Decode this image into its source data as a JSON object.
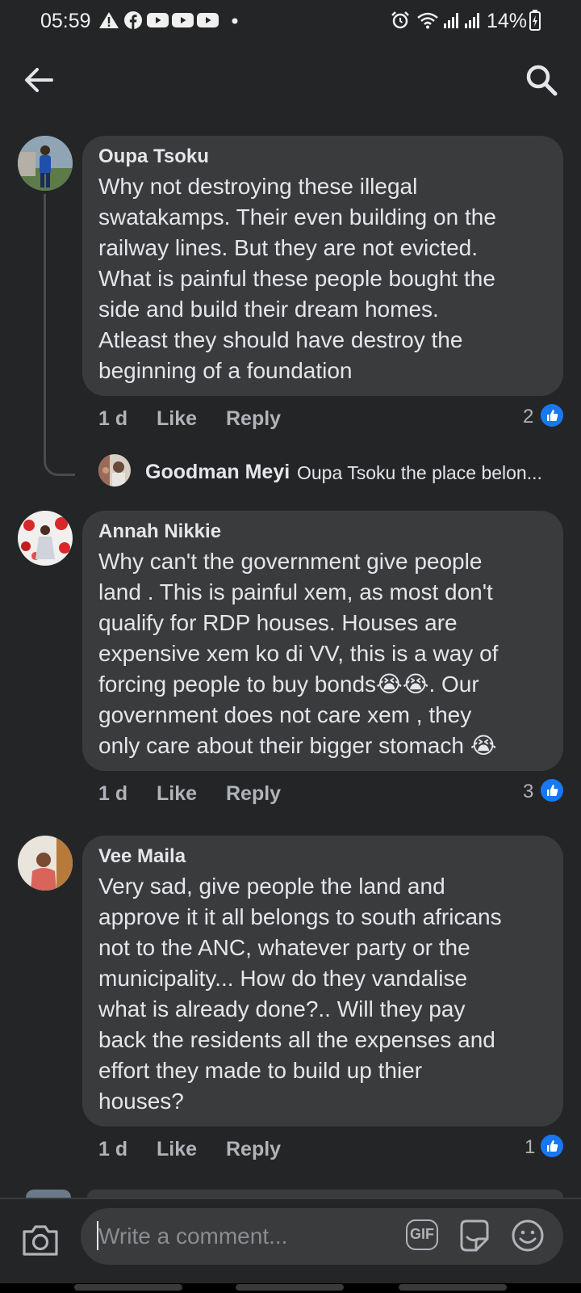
{
  "status_bar": {
    "time": "05:59",
    "battery": "14%",
    "left_icons": [
      "warning-icon",
      "facebook-icon",
      "youtube-icon",
      "youtube-icon",
      "youtube-icon",
      "dot-icon"
    ],
    "right_icons": [
      "alarm-icon",
      "wifi-icon",
      "signal-icon",
      "signal-icon",
      "battery-icon"
    ]
  },
  "top_bar": {
    "back_icon": "arrow-left-icon",
    "search_icon": "search-icon"
  },
  "comments": [
    {
      "author": "Oupa Tsoku",
      "text_lines": [
        "Why not destroying these illegal",
        "swatakamps. Their even building on the",
        "railway lines.  But they are not evicted.",
        "What is painful these people bought the",
        "side and build their dream homes.",
        "Atleast they should have destroy the",
        "beginning of a foundation"
      ],
      "time": "1 d",
      "like_label": "Like",
      "reply_label": "Reply",
      "reactions": "2",
      "reply_preview": {
        "author": "Goodman Meyi",
        "snippet": "Oupa Tsoku the place belon..."
      }
    },
    {
      "author": "Annah Nikkie",
      "text_lines": [
        "Why can't the government give people",
        "land . This is painful xem, as most don't",
        "qualify for RDP houses. Houses are",
        "expensive xem ko di VV, this is a way of",
        "forcing people to buy bonds😭😭. Our",
        "government does not care xem , they",
        "only care about their bigger stomach 😭"
      ],
      "time": "1 d",
      "like_label": "Like",
      "reply_label": "Reply",
      "reactions": "3"
    },
    {
      "author": "Vee Maila",
      "text_lines": [
        "Very sad, give people the land and",
        "approve it it all belongs to south africans",
        "not to the ANC, whatever party or the",
        "municipality... How do they vandalise",
        "what is already done?.. Will they pay",
        "back the residents all the expenses and",
        "effort they made to build up thier",
        "houses?"
      ],
      "time": "1 d",
      "like_label": "Like",
      "reply_label": "Reply",
      "reactions": "1"
    }
  ],
  "composer": {
    "placeholder": "Write a comment...",
    "gif_label": "GIF",
    "camera_icon": "camera-icon",
    "sticker_icon": "sticker-icon",
    "emoji_icon": "emoji-icon"
  },
  "colors": {
    "background": "#242526",
    "bubble": "#3a3b3c",
    "like_blue": "#1877f2",
    "text": "#e4e6eb",
    "secondary_text": "#b0b3b8"
  }
}
